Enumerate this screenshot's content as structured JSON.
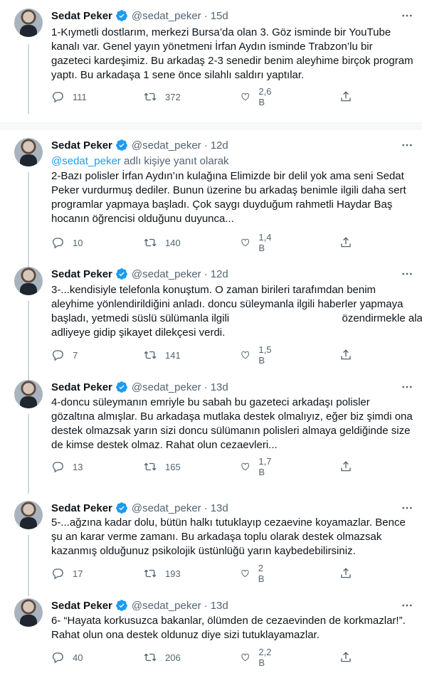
{
  "colors": {
    "accent": "#1d9bf0",
    "text": "#0f1419",
    "secondary": "#536471"
  },
  "tweets": [
    {
      "name": "Sedat Peker",
      "handle": "@sedat_peker",
      "time": "15d",
      "reply_to": null,
      "lines": [
        "1-Kıymetli dostlarım, merkezi Bursa’da olan 3. Göz isminde bir YouTube",
        "kanalı var. Genel yayın yönetmeni İrfan Aydın isminde Trabzon’lu bir",
        "gazeteci kardeşimiz. Bu arkadaş 2-3 senedir benim aleyhime birçok program",
        "yaptı. Bu arkadaşa 1 sene önce silahlı saldırı yaptılar."
      ],
      "replies": "111",
      "retweets": "372",
      "likes": "2,6 B"
    },
    {
      "name": "Sedat Peker",
      "handle": "@sedat_peker",
      "time": "12d",
      "reply_to": {
        "mention": "@sedat_peker",
        "suffix": " adlı kişiye yanıt olarak"
      },
      "lines": [
        "2-Bazı polisler İrfan Aydın’ın kulağına Elimizde bir delil yok ama seni Sedat",
        "Peker vurdurmuş dediler. Bunun üzerine bu arkadaş benimle ilgili daha sert",
        "programlar yapmaya başladı. Çok saygı duyduğum rahmetli Haydar Baş",
        "hocanın öğrencisi olduğunu duyunca..."
      ],
      "replies": "10",
      "retweets": "140",
      "likes": "1,4 B"
    },
    {
      "name": "Sedat Peker",
      "handle": "@sedat_peker",
      "time": "12d",
      "reply_to": null,
      "lines": [
        "3-...kendisiyle telefonla konuştum. O zaman birileri tarafımdan benim",
        "aleyhime yönlendirildiğini anladı. doncu süleymanla ilgili haberler yapmaya",
        "başladı, yetmedi süslü sülümanla ilgili                                      özendirmekle alakalı",
        "adliyeye gidip şikayet dilekçesi verdi."
      ],
      "replies": "7",
      "retweets": "141",
      "likes": "1,5 B"
    },
    {
      "name": "Sedat Peker",
      "handle": "@sedat_peker",
      "time": "13d",
      "reply_to": null,
      "lines": [
        "4-doncu süleymanın emriyle bu sabah bu gazeteci arkadaşı polisler",
        "gözaltına almışlar. Bu arkadaşa mutlaka destek olmalıyız, eğer biz şimdi ona",
        "destek olmazsak yarın sizi doncu sülümanın polisleri almaya geldiğinde size",
        "de kimse destek olmaz. Rahat olun cezaevleri..."
      ],
      "replies": "13",
      "retweets": "165",
      "likes": "1,7 B"
    },
    {
      "name": "Sedat Peker",
      "handle": "@sedat_peker",
      "time": "13d",
      "reply_to": null,
      "lines": [
        "5-...ağzına kadar dolu, bütün halkı tutuklayıp cezaevine koyamazlar. Bence",
        "şu an karar verme zamanı. Bu arkadaşa toplu olarak destek olmazsak",
        "kazanmış olduğunuz psikolojik üstünlüğü yarın kaybedebilirsiniz."
      ],
      "replies": "17",
      "retweets": "193",
      "likes": "2 B"
    },
    {
      "name": "Sedat Peker",
      "handle": "@sedat_peker",
      "time": "13d",
      "reply_to": null,
      "lines": [
        "6- “Hayata korkusuzca bakanlar, ölümden de cezaevinden de korkmazlar!”.",
        "Rahat olun ona destek oldunuz diye sizi tutuklayamazlar."
      ],
      "replies": "40",
      "retweets": "206",
      "likes": "2,2 B"
    }
  ]
}
